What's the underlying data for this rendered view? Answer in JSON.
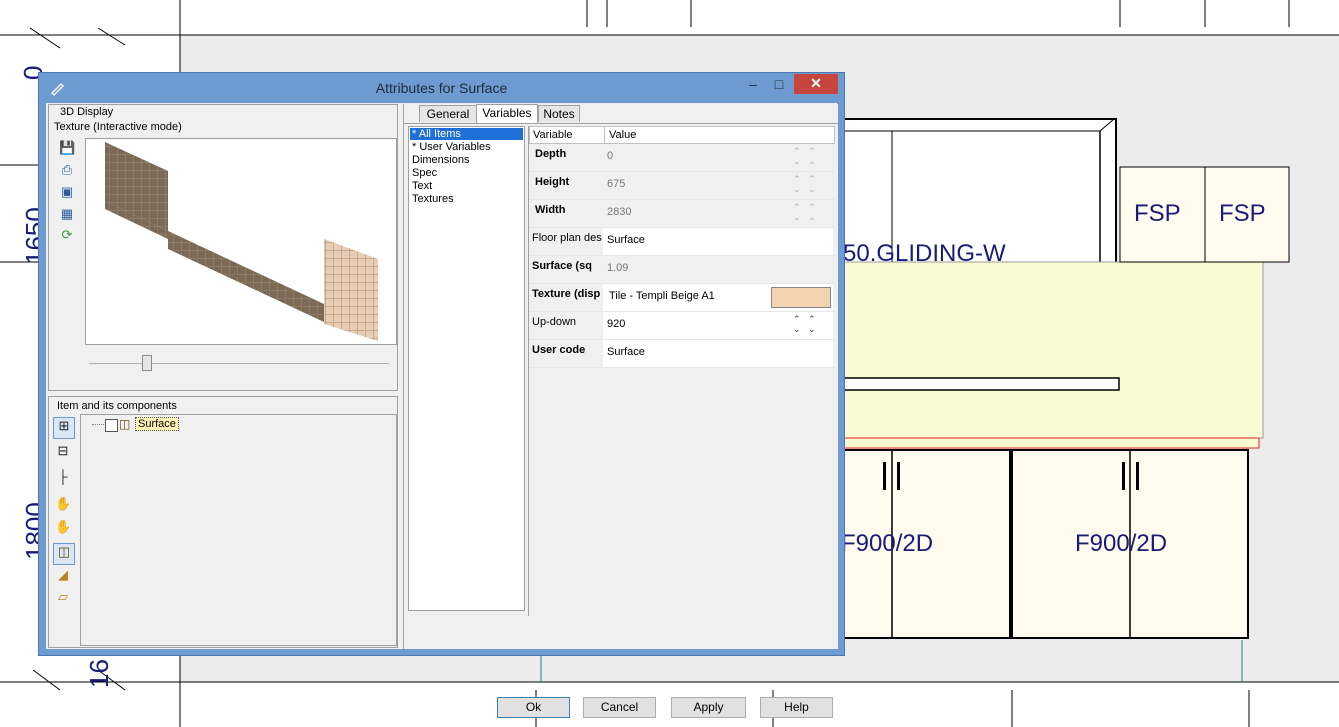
{
  "background_drawing": {
    "left_dims": [
      "0",
      "1650",
      "1800",
      "16"
    ],
    "cabinet_labels": {
      "upper_unit": "50.GLIDING-W",
      "fsp_left": "FSP",
      "fsp_right": "FSP",
      "base_left": "F900/2D",
      "base_right": "F900/2D"
    }
  },
  "dialog": {
    "title": "Attributes for Surface",
    "minimize_label": "–",
    "maximize_label": "□",
    "close_label": "✕",
    "display_group": {
      "label": "3D Display",
      "mode": "Texture (Interactive mode)",
      "toolbar_icons": [
        "save-icon",
        "print-icon",
        "monitor-icon",
        "screenshot-icon",
        "refresh-icon"
      ]
    },
    "components_group": {
      "label": "Item and its components",
      "tree_item": "Surface",
      "toolbar_icons": [
        "expand-icon",
        "collapse-icon",
        "tree-icon",
        "hand-icon",
        "hand2-icon",
        "box-3d-icon",
        "surface-icon",
        "plane-icon"
      ]
    },
    "tabs": [
      "General",
      "Variables",
      "Notes"
    ],
    "active_tab": "Variables",
    "categories": [
      "* All Items",
      "* User Variables",
      "Dimensions",
      "Spec",
      "Text",
      "Textures"
    ],
    "selected_category": "* All Items",
    "grid": {
      "col_variable": "Variable",
      "col_value": "Value",
      "rows": [
        {
          "name": "Depth",
          "value": "0"
        },
        {
          "name": "Height",
          "value": "675"
        },
        {
          "name": "Width",
          "value": "2830"
        },
        {
          "name": "Floor plan des",
          "value": "Surface"
        },
        {
          "name": "Surface (sq",
          "value": "1.09"
        },
        {
          "name": "Texture (disp",
          "value": "Tile - Templi Beige A1"
        },
        {
          "name": "Up-down",
          "value": "920"
        },
        {
          "name": "User code",
          "value": "Surface"
        }
      ],
      "texture_swatch_color": "#f2d2b0"
    },
    "buttons": {
      "ok": "Ok",
      "cancel": "Cancel",
      "apply": "Apply",
      "help": "Help"
    }
  },
  "colors": {
    "titlebar": "#6d9bd1",
    "close": "#c7453c",
    "cad_panel": "#ececec",
    "counter": "#fafad2",
    "label_text": "#1a1a7a"
  }
}
